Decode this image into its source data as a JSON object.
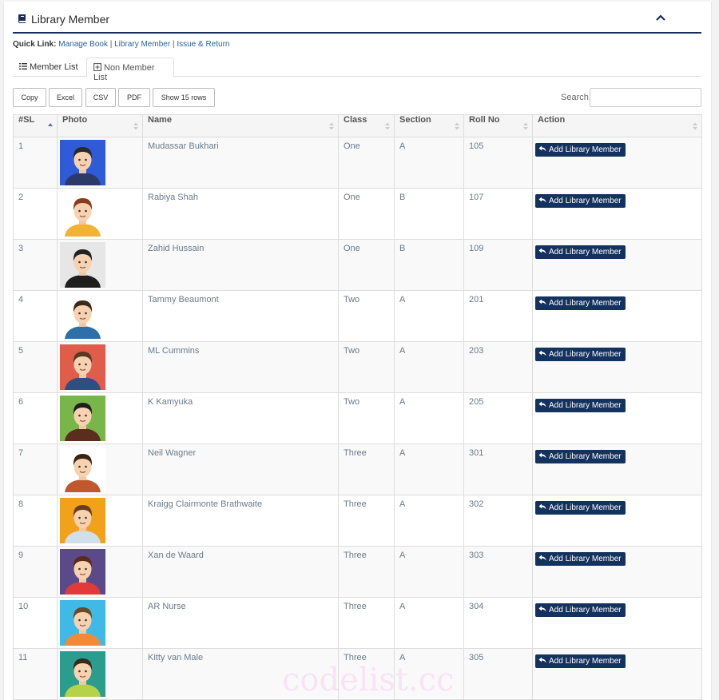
{
  "header": {
    "title": "Library Member"
  },
  "quick_links": {
    "label": "Quick Link:",
    "links": [
      "Manage Book",
      "Library Member",
      "Issue & Return"
    ],
    "separator": "|"
  },
  "tabs": [
    {
      "label": "Member List",
      "icon": "list-icon"
    },
    {
      "label": "Non Member List",
      "icon": "square-plus-icon",
      "active": true
    }
  ],
  "toolbar": {
    "buttons": [
      "Copy",
      "Excel",
      "CSV",
      "PDF",
      "Show 15 rows"
    ],
    "search_label": "Search:",
    "search_value": ""
  },
  "table": {
    "columns": [
      "#SL",
      "Photo",
      "Name",
      "Class",
      "Section",
      "Roll No",
      "Action"
    ],
    "action_label": "Add Library Member",
    "rows": [
      {
        "sl": "1",
        "name": "Mudassar Bukhari",
        "class": "One",
        "section": "A",
        "roll": "105",
        "avatar_bg": "#2f5ad8",
        "hair": "#2a2a2a",
        "shirt": "#2b3a67"
      },
      {
        "sl": "2",
        "name": "Rabiya Shah",
        "class": "One",
        "section": "B",
        "roll": "107",
        "avatar_bg": "#ffffff",
        "hair": "#8a3b1e",
        "shirt": "#f2b233"
      },
      {
        "sl": "3",
        "name": "Zahid Hussain",
        "class": "One",
        "section": "B",
        "roll": "109",
        "avatar_bg": "#e6e6e6",
        "hair": "#222222",
        "shirt": "#1e1e1e"
      },
      {
        "sl": "4",
        "name": "Tammy Beaumont",
        "class": "Two",
        "section": "A",
        "roll": "201",
        "avatar_bg": "#ffffff",
        "hair": "#3b2a1a",
        "shirt": "#2e6fa8"
      },
      {
        "sl": "5",
        "name": "ML Cummins",
        "class": "Two",
        "section": "A",
        "roll": "203",
        "avatar_bg": "#e05c4b",
        "hair": "#5a3a22",
        "shirt": "#2f4f7f"
      },
      {
        "sl": "6",
        "name": "K Kamyuka",
        "class": "Two",
        "section": "A",
        "roll": "205",
        "avatar_bg": "#79b64a",
        "hair": "#1e1e1e",
        "shirt": "#5a2d1e"
      },
      {
        "sl": "7",
        "name": "Neil Wagner",
        "class": "Three",
        "section": "A",
        "roll": "301",
        "avatar_bg": "#ffffff",
        "hair": "#3a2410",
        "shirt": "#c0582b"
      },
      {
        "sl": "8",
        "name": "Kraigg Clairmonte Brathwaite",
        "class": "Three",
        "section": "A",
        "roll": "302",
        "avatar_bg": "#f2a11a",
        "hair": "#6b3d1f",
        "shirt": "#cfe0ea"
      },
      {
        "sl": "9",
        "name": "Xan de Waard",
        "class": "Three",
        "section": "A",
        "roll": "303",
        "avatar_bg": "#5b4a8a",
        "hair": "#5a2a1a",
        "shirt": "#e23a3a"
      },
      {
        "sl": "10",
        "name": "AR Nurse",
        "class": "Three",
        "section": "A",
        "roll": "304",
        "avatar_bg": "#3fb9e6",
        "hair": "#6b4a2a",
        "shirt": "#f08a3a"
      },
      {
        "sl": "11",
        "name": "Kitty van Male",
        "class": "Three",
        "section": "A",
        "roll": "305",
        "avatar_bg": "#2a9d8f",
        "hair": "#3a2a1a",
        "shirt": "#b6d14a"
      }
    ]
  },
  "watermark": "codelist.cc"
}
